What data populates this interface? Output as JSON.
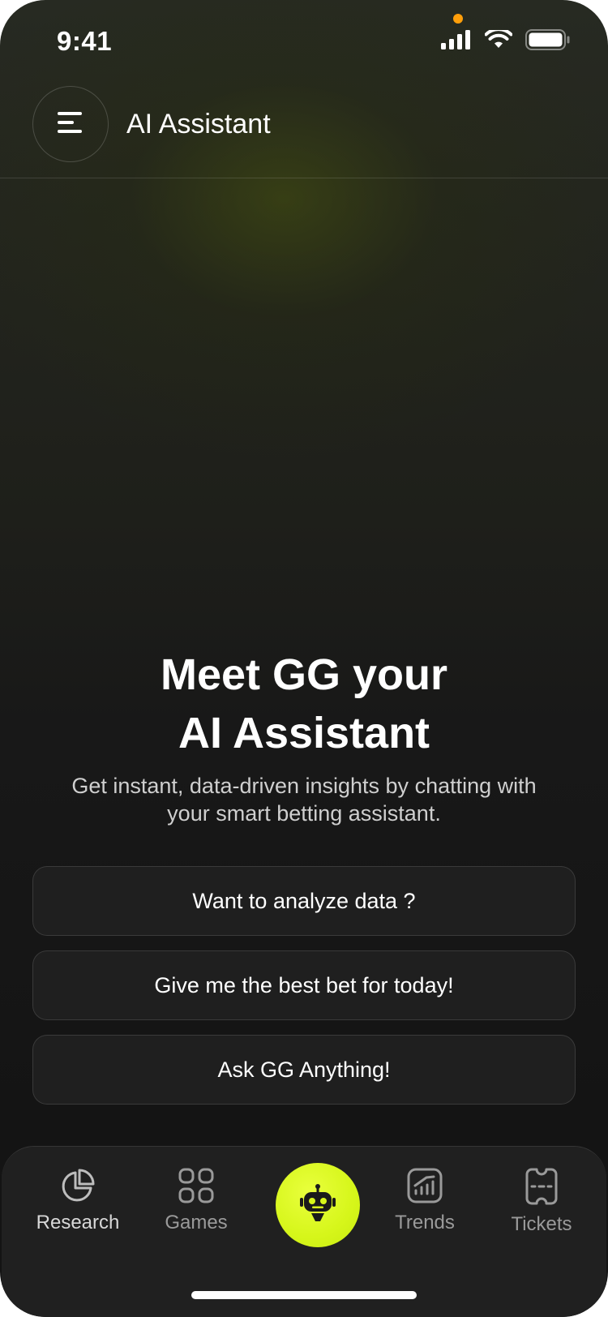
{
  "status_bar": {
    "time": "9:41"
  },
  "header": {
    "title": "AI Assistant",
    "menu_icon": "menu-icon"
  },
  "hero": {
    "title_line1": "Meet GG your",
    "title_line2": "AI Assistant",
    "subtitle": "Get instant, data-driven insights by chatting with your smart betting assistant."
  },
  "suggestions": [
    {
      "label": "Want to analyze data ?"
    },
    {
      "label": "Give me the best bet for today!"
    },
    {
      "label": "Ask GG Anything!"
    }
  ],
  "tabbar": {
    "tabs": [
      {
        "label": "Research",
        "icon": "pie-chart-icon",
        "active": true
      },
      {
        "label": "Games",
        "icon": "grid-icon",
        "active": false
      },
      {
        "label": "",
        "icon": "robot-icon",
        "active": false
      },
      {
        "label": "Trends",
        "icon": "trend-chart-icon",
        "active": false
      },
      {
        "label": "Tickets",
        "icon": "ticket-icon",
        "active": false
      }
    ]
  },
  "colors": {
    "accent": "#d6f61a",
    "background": "#141414",
    "recording_dot": "#ff9f0a"
  }
}
